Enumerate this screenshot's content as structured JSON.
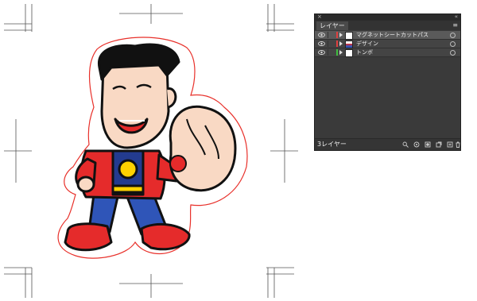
{
  "layers_panel": {
    "close_glyph": "×",
    "collapse_glyph": "«",
    "tab_label": "レイヤー",
    "menu_glyph": "≡",
    "layers": [
      {
        "name": "マグネットシートカットパス",
        "color": "#e04040",
        "selected": true
      },
      {
        "name": "デザイン",
        "color": "#e04040",
        "selected": false
      },
      {
        "name": "トンボ",
        "color": "#3fbf3f",
        "selected": false
      }
    ],
    "layer_count": "3レイヤー",
    "footer_icons": [
      "search-icon",
      "locate-object-icon",
      "make-clipping-mask-icon",
      "new-sublayer-icon",
      "new-layer-icon",
      "trash-icon"
    ]
  },
  "canvas": {
    "cut_path_color": "#e8302a",
    "crop_mark_color": "#444444"
  }
}
